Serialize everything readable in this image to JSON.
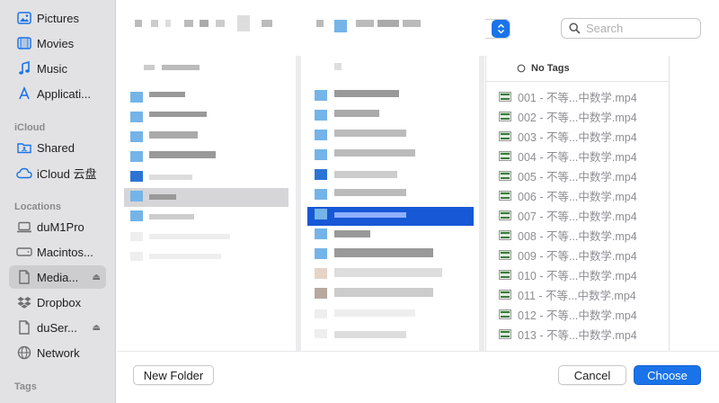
{
  "sidebar": {
    "favorites": [
      {
        "label": "Pictures",
        "icon": "photo-icon"
      },
      {
        "label": "Movies",
        "icon": "film-icon"
      },
      {
        "label": "Music",
        "icon": "music-note-icon"
      },
      {
        "label": "Applicati...",
        "icon": "applications-icon"
      }
    ],
    "icloud_header": "iCloud",
    "icloud": [
      {
        "label": "Shared",
        "icon": "shared-folder-icon"
      },
      {
        "label": "iCloud 云盘",
        "icon": "cloud-icon"
      }
    ],
    "locations_header": "Locations",
    "locations": [
      {
        "label": "duM1Pro",
        "icon": "laptop-icon"
      },
      {
        "label": "Macintos...",
        "icon": "disk-icon"
      },
      {
        "label": "Media...",
        "icon": "document-icon",
        "eject": "⏏",
        "selected": true
      },
      {
        "label": "Dropbox",
        "icon": "dropbox-icon"
      },
      {
        "label": "duSer...",
        "icon": "document-icon",
        "eject": "⏏"
      },
      {
        "label": "Network",
        "icon": "globe-icon"
      }
    ],
    "tags_header": "Tags"
  },
  "toolbar": {
    "search_placeholder": "Search"
  },
  "tags_column": {
    "header": "No Tags",
    "files": [
      "001 - 不等...中数学.mp4",
      "002 - 不等...中数学.mp4",
      "003 - 不等...中数学.mp4",
      "004 - 不等...中数学.mp4",
      "005 - 不等...中数学.mp4",
      "006 - 不等...中数学.mp4",
      "007 - 不等...中数学.mp4",
      "008 - 不等...中数学.mp4",
      "009 - 不等...中数学.mp4",
      "010 - 不等...中数学.mp4",
      "011 - 不等...中数学.mp4",
      "012 - 不等...中数学.mp4",
      "013 - 不等...中数学.mp4"
    ]
  },
  "buttons": {
    "new_folder": "New Folder",
    "cancel": "Cancel",
    "choose": "Choose"
  },
  "colors": {
    "accent": "#1a73e8",
    "selection_blue": "#1758d6",
    "sidebar_bg": "#e2e2e4"
  }
}
